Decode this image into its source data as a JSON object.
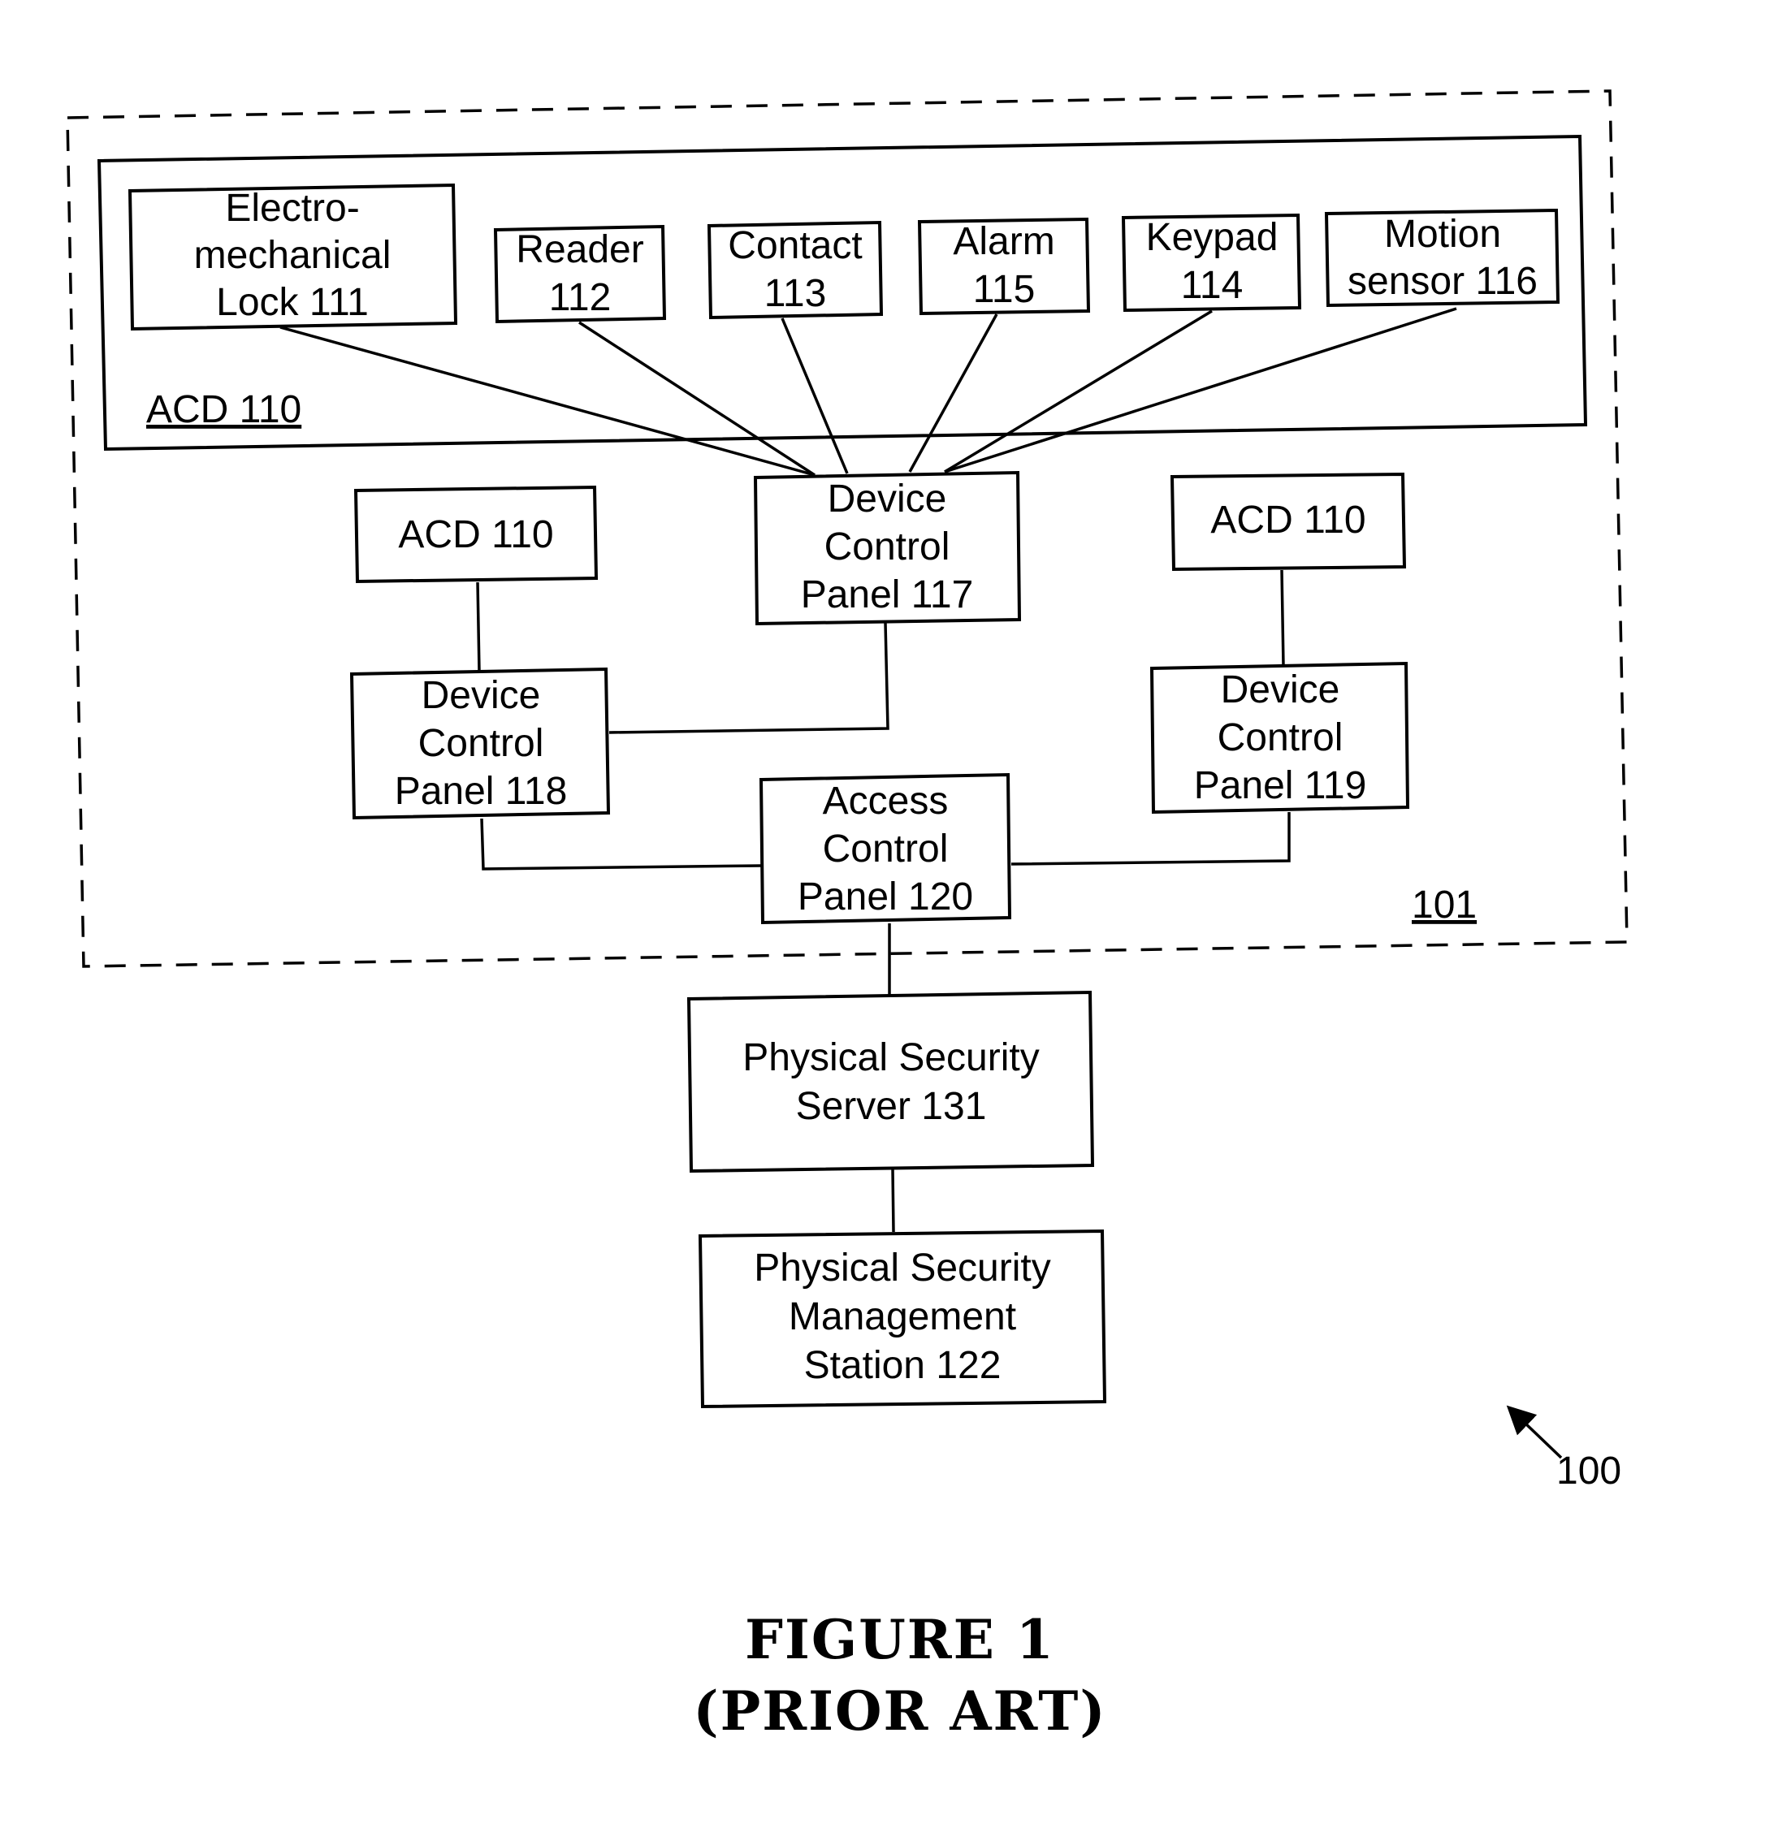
{
  "figure": {
    "caption_line1": "FIGURE 1",
    "caption_line2": "(PRIOR ART)",
    "system_ref": "100",
    "site_ref": "101"
  },
  "acd_group": {
    "label": "ACD 110",
    "devices": [
      {
        "id": "111",
        "lines": [
          "Electro-",
          "mechanical",
          "Lock 111"
        ]
      },
      {
        "id": "112",
        "lines": [
          "Reader",
          "112"
        ]
      },
      {
        "id": "113",
        "lines": [
          "Contact",
          "113"
        ]
      },
      {
        "id": "115",
        "lines": [
          "Alarm",
          "115"
        ]
      },
      {
        "id": "114",
        "lines": [
          "Keypad",
          "114"
        ]
      },
      {
        "id": "116",
        "lines": [
          "Motion",
          "sensor 116"
        ]
      }
    ]
  },
  "nodes": {
    "dcp117": {
      "lines": [
        "Device",
        "Control",
        "Panel 117"
      ]
    },
    "acd_left": {
      "label": "ACD 110"
    },
    "acd_right": {
      "label": "ACD 110"
    },
    "dcp118": {
      "lines": [
        "Device",
        "Control",
        "Panel 118"
      ]
    },
    "dcp119": {
      "lines": [
        "Device",
        "Control",
        "Panel 119"
      ]
    },
    "acp120": {
      "lines": [
        "Access",
        "Control",
        "Panel 120"
      ]
    },
    "server131": {
      "lines": [
        "Physical Security",
        "Server 131"
      ]
    },
    "station122": {
      "lines": [
        "Physical Security",
        "Management",
        "Station 122"
      ]
    }
  },
  "connections": [
    {
      "from": "Electro-mechanical Lock 111",
      "to": "Device Control Panel 117"
    },
    {
      "from": "Reader 112",
      "to": "Device Control Panel 117"
    },
    {
      "from": "Contact 113",
      "to": "Device Control Panel 117"
    },
    {
      "from": "Alarm 115",
      "to": "Device Control Panel 117"
    },
    {
      "from": "Keypad 114",
      "to": "Device Control Panel 117"
    },
    {
      "from": "Motion sensor 116",
      "to": "Device Control Panel 117"
    },
    {
      "from": "ACD 110",
      "to": "Device Control Panel 118"
    },
    {
      "from": "ACD 110",
      "to": "Device Control Panel 119"
    },
    {
      "from": "Device Control Panel 117",
      "to": "Device Control Panel 118"
    },
    {
      "from": "Device Control Panel 118",
      "to": "Access Control Panel 120"
    },
    {
      "from": "Device Control Panel 119",
      "to": "Access Control Panel 120"
    },
    {
      "from": "Access Control Panel 120",
      "to": "Physical Security Server 131"
    },
    {
      "from": "Physical Security Server 131",
      "to": "Physical Security Management Station 122"
    }
  ]
}
